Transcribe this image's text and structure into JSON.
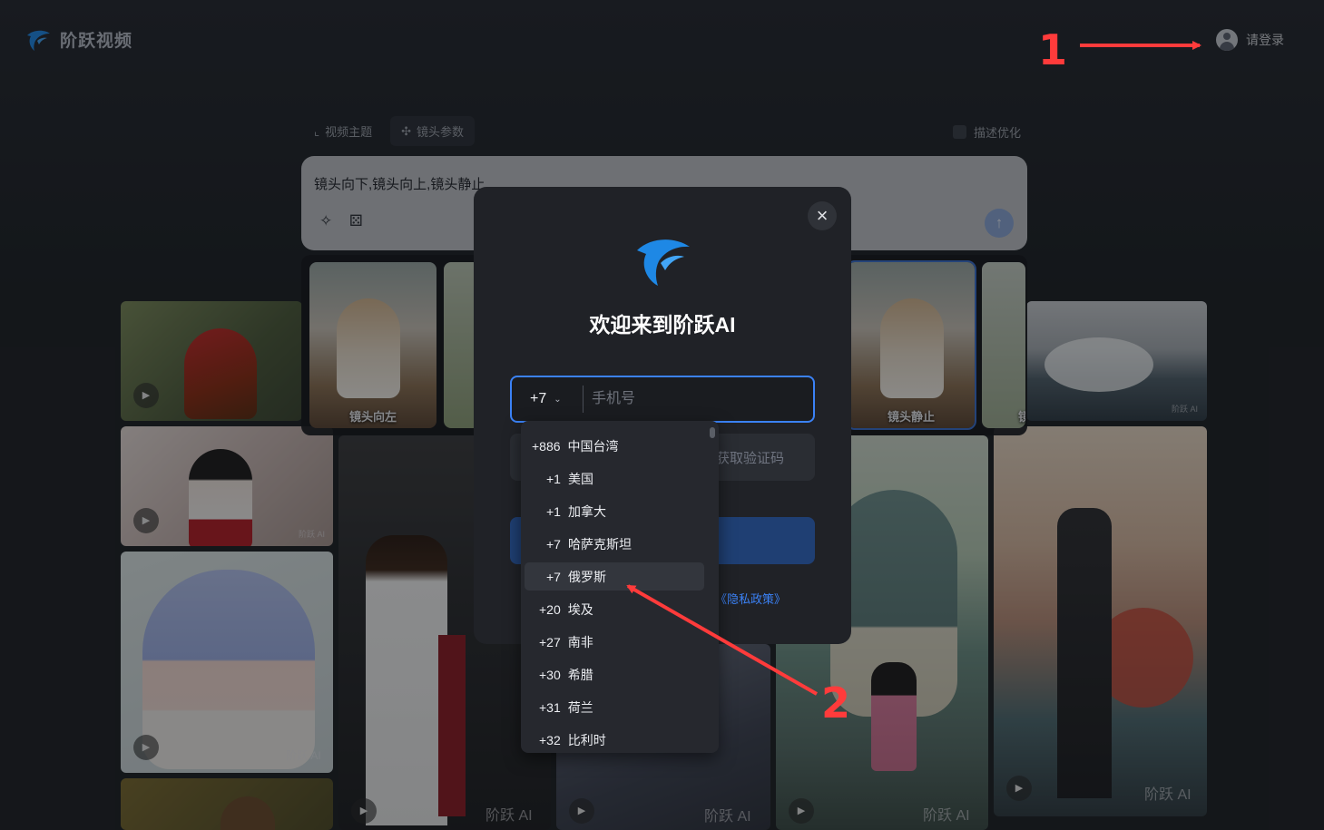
{
  "header": {
    "logo_text": "阶跃视频",
    "login_text": "请登录"
  },
  "toolbar": {
    "video_theme": "视频主题",
    "camera_params": "镜头参数",
    "describe_optimize": "描述优化"
  },
  "prompt": {
    "text": "镜头向下,镜头向上,镜头静止"
  },
  "templates": [
    {
      "label": "镜头向左"
    },
    {
      "label": "镜头静止"
    },
    {
      "label": "镜"
    }
  ],
  "gallery": {
    "watermark": "阶跃 AI"
  },
  "modal": {
    "title": "欢迎来到阶跃AI",
    "country_code": "+7",
    "phone_placeholder": "手机号",
    "code_button": "获取验证码",
    "privacy_link": "《隐私政策》"
  },
  "country_options": [
    {
      "code": "+886",
      "name": "中国台湾"
    },
    {
      "code": "+1",
      "name": "美国"
    },
    {
      "code": "+1",
      "name": "加拿大"
    },
    {
      "code": "+7",
      "name": "哈萨克斯坦"
    },
    {
      "code": "+7",
      "name": "俄罗斯"
    },
    {
      "code": "+20",
      "name": "埃及"
    },
    {
      "code": "+27",
      "name": "南非"
    },
    {
      "code": "+30",
      "name": "希腊"
    },
    {
      "code": "+31",
      "name": "荷兰"
    },
    {
      "code": "+32",
      "name": "比利时"
    }
  ],
  "annotations": {
    "step1": "1",
    "step2": "2"
  },
  "colors": {
    "accent": "#3b82f6",
    "annotation": "#ff3b3b",
    "modal_bg": "#202227"
  },
  "icons": {
    "logo": "dolphin-logo-icon",
    "login": "user-avatar-icon",
    "close": "close-icon",
    "dropdown": "chevron-down-icon",
    "send": "arrow-up-icon"
  }
}
